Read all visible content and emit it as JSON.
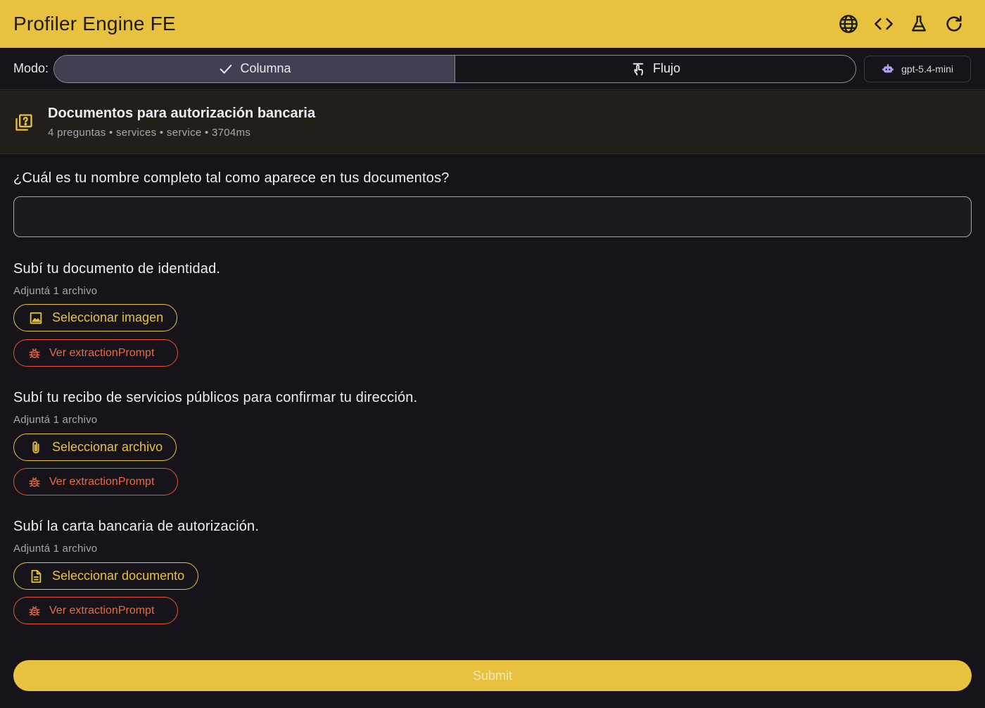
{
  "app": {
    "title": "Profiler Engine FE"
  },
  "appbar_actions": [
    {
      "icon": "globe-icon"
    },
    {
      "icon": "code-icon"
    },
    {
      "icon": "flask-icon"
    },
    {
      "icon": "refresh-icon"
    }
  ],
  "mode": {
    "label": "Modo:",
    "options": [
      {
        "label": "Columna",
        "selected": true,
        "icon": "check-icon"
      },
      {
        "label": "Flujo",
        "selected": false,
        "icon": "touch-icon"
      }
    ],
    "model": "gpt-5.4-mini"
  },
  "header": {
    "title": "Documentos para autorización bancaria",
    "meta": "4 preguntas • services • service • 3704ms"
  },
  "questions": [
    {
      "title": "¿Cuál es tu nombre completo tal como aparece en tus documentos?",
      "value": ""
    },
    {
      "title": "Subí tu documento de identidad.",
      "subtitle": "Adjuntá 1 archivo",
      "button": "Seleccionar imagen",
      "button_icon": "image-icon",
      "debug_button": "Ver extractionPrompt"
    },
    {
      "title": "Subí tu recibo de servicios públicos para confirmar tu dirección.",
      "subtitle": "Adjuntá 1 archivo",
      "button": "Seleccionar archivo",
      "button_icon": "paperclip-icon",
      "debug_button": "Ver extractionPrompt"
    },
    {
      "title": "Subí la carta bancaria de autorización.",
      "subtitle": "Adjuntá 1 archivo",
      "button": "Seleccionar documento",
      "button_icon": "document-icon",
      "debug_button": "Ver extractionPrompt"
    }
  ],
  "submit": {
    "label": "Submit"
  },
  "colors": {
    "accent": "#e8c13e",
    "danger": "#e8542e",
    "background": "#16141a"
  }
}
